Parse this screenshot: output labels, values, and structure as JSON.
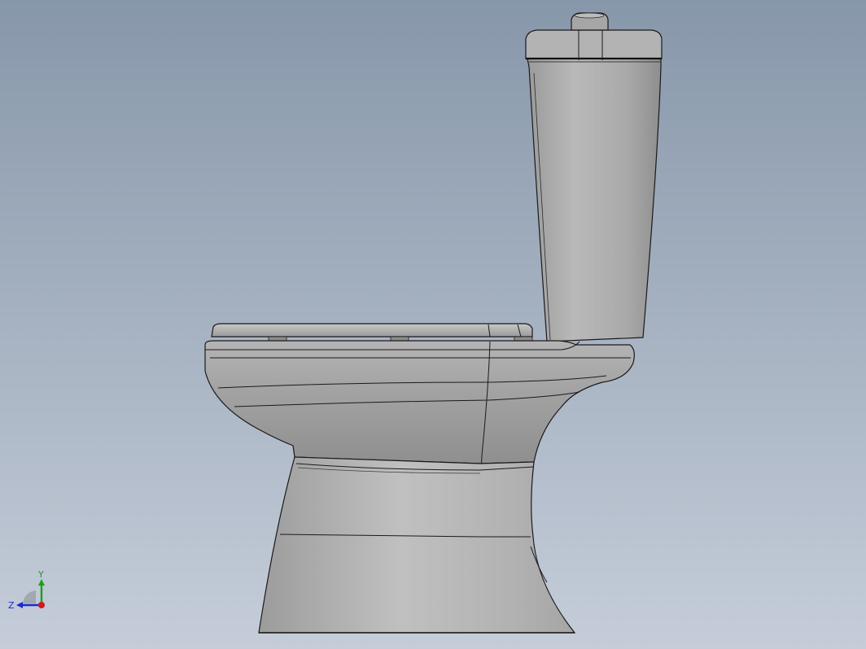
{
  "viewport": {
    "background_top": "#8797aa",
    "background_bottom": "#c5cdd9"
  },
  "model": {
    "component": "toilet",
    "view": "side",
    "shading_color": "#a8a8a8",
    "edge_color": "#1a1a1a"
  },
  "triad": {
    "y_label": "Y",
    "z_label": "Z",
    "y_color": "#1aa01a",
    "z_color": "#1a2ad0",
    "x_color": "#d01a1a"
  }
}
